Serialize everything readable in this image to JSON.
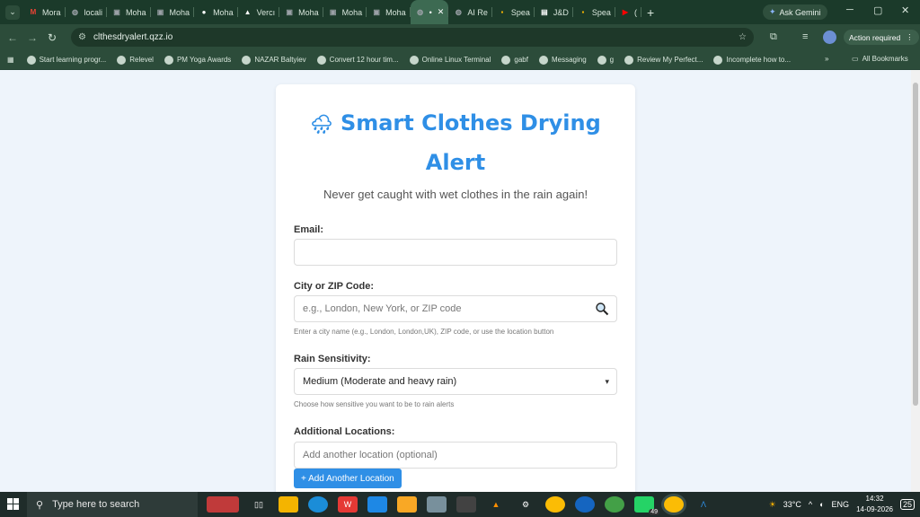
{
  "browser": {
    "tabs": [
      {
        "label": "Mora",
        "color": "#ea4335",
        "glyph": "M"
      },
      {
        "label": "locali",
        "color": "#9aa0a6",
        "glyph": "◍"
      },
      {
        "label": "Moha",
        "color": "#9aa0a6",
        "glyph": "▣"
      },
      {
        "label": "Moha",
        "color": "#9aa0a6",
        "glyph": "▣"
      },
      {
        "label": "Moha",
        "color": "#ffffff",
        "glyph": "●"
      },
      {
        "label": "Vercı",
        "color": "#ffffff",
        "glyph": "▲"
      },
      {
        "label": "Moha",
        "color": "#9aa0a6",
        "glyph": "▣"
      },
      {
        "label": "Moha",
        "color": "#9aa0a6",
        "glyph": "▣"
      },
      {
        "label": "Moha",
        "color": "#9aa0a6",
        "glyph": "▣"
      },
      {
        "label": "•",
        "color": "#9aa0a6",
        "glyph": "◍",
        "active": true
      },
      {
        "label": "AI Re",
        "color": "#9aa0a6",
        "glyph": "◍"
      },
      {
        "label": "Spea",
        "color": "#f4b400",
        "glyph": "▪"
      },
      {
        "label": "J&D",
        "color": "#ffffff",
        "glyph": "▤"
      },
      {
        "label": "Spea",
        "color": "#f4b400",
        "glyph": "▪"
      },
      {
        "label": "(",
        "color": "#ff0000",
        "glyph": "▶"
      }
    ],
    "ask_gemini": "Ask Gemini",
    "url": "clthesdryalert.qzz.io",
    "action_required": "Action required",
    "bookmarks": [
      "Start learning progr...",
      "Relevel",
      "PM Yoga Awards",
      "NAZAR Baltyiev",
      "Convert 12 hour tim...",
      "Online Linux Terminal",
      "gabf",
      "Messaging",
      "g",
      "Review  My Perfect...",
      "Incomplete how to..."
    ],
    "all_bookmarks": "All Bookmarks"
  },
  "page": {
    "title_icon": "🌧",
    "title": "Smart Clothes Drying Alert",
    "subtitle": "Never get caught with wet clothes in the rain again!",
    "email_label": "Email:",
    "email_value": "",
    "city_label": "City or ZIP Code:",
    "city_placeholder": "e.g., London, New York, or ZIP code",
    "city_help": "Enter a city name (e.g., London, London,UK), ZIP code, or use the location button",
    "sensitivity_label": "Rain Sensitivity:",
    "sensitivity_value": "Medium (Moderate and heavy rain)",
    "sensitivity_help": "Choose how sensitive you want to be to rain alerts",
    "additional_label": "Additional Locations:",
    "additional_placeholder": "Add another location (optional)",
    "add_location_button": "+ Add Another Location",
    "accent_color": "#2f8fe6"
  },
  "taskbar": {
    "search_placeholder": "Type here to search",
    "whatsapp_badge": "49",
    "temperature": "33°C",
    "language": "ENG",
    "time": "14:32",
    "date": "14-09-2026",
    "notifications": "25"
  }
}
